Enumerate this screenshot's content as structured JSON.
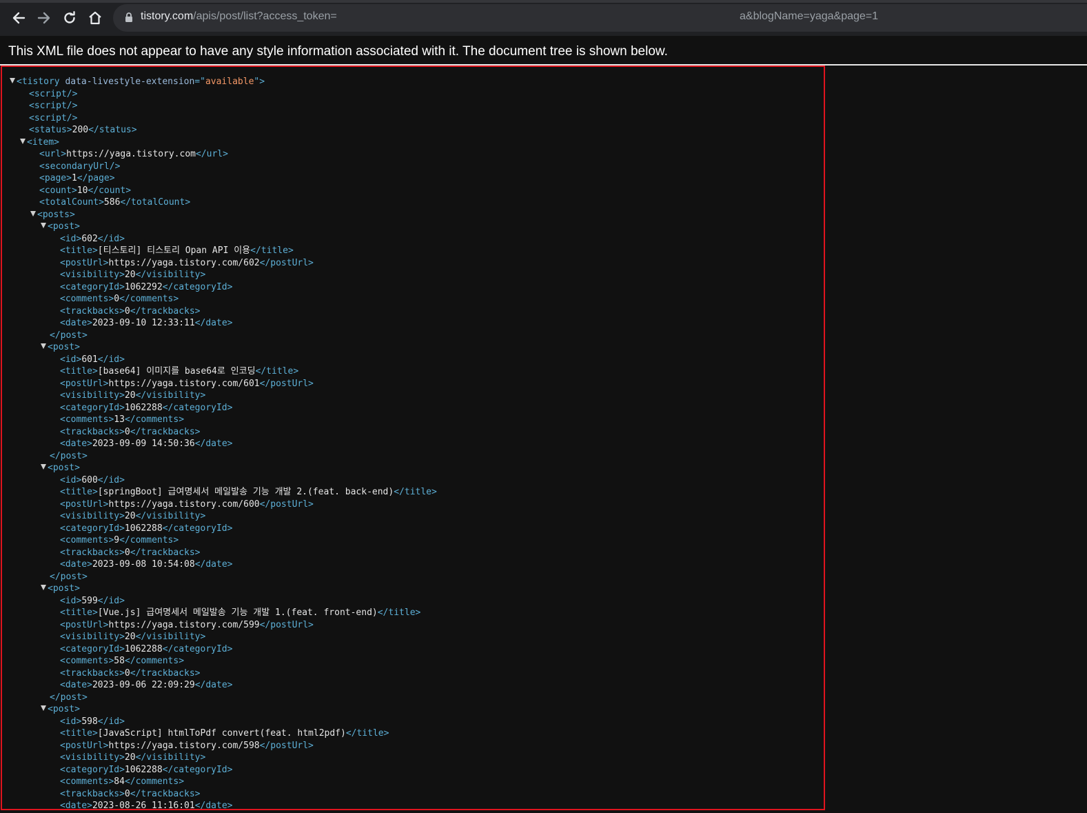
{
  "browser": {
    "url_host": "tistory.com",
    "url_path": "/apis/post/list?access_token=",
    "url_tail": "a&blogName=yaga&page=1"
  },
  "info_message": "This XML file does not appear to have any style information associated with it. The document tree is shown below.",
  "xml": {
    "root_attr_name": "data-livestyle-extension",
    "root_attr_value": "available",
    "status": "200",
    "url": "https://yaga.tistory.com",
    "page": "1",
    "count": "10",
    "totalCount": "586",
    "posts": [
      {
        "id": "602",
        "title": "[티스토리] 티스토리 Opan API 이용",
        "postUrl": "https://yaga.tistory.com/602",
        "visibility": "20",
        "categoryId": "1062292",
        "comments": "0",
        "trackbacks": "0",
        "date": "2023-09-10 12:33:11"
      },
      {
        "id": "601",
        "title": "[base64] 이미지를 base64로 인코딩",
        "postUrl": "https://yaga.tistory.com/601",
        "visibility": "20",
        "categoryId": "1062288",
        "comments": "13",
        "trackbacks": "0",
        "date": "2023-09-09 14:50:36"
      },
      {
        "id": "600",
        "title": "[springBoot] 급여명세서 메일발송 기능 개발 2.(feat. back-end)",
        "postUrl": "https://yaga.tistory.com/600",
        "visibility": "20",
        "categoryId": "1062288",
        "comments": "9",
        "trackbacks": "0",
        "date": "2023-09-08 10:54:08"
      },
      {
        "id": "599",
        "title": "[Vue.js] 급여명세서 메일발송 기능 개발 1.(feat. front-end)",
        "postUrl": "https://yaga.tistory.com/599",
        "visibility": "20",
        "categoryId": "1062288",
        "comments": "58",
        "trackbacks": "0",
        "date": "2023-09-06 22:09:29"
      },
      {
        "id": "598",
        "title": "[JavaScript] htmlToPdf convert(feat. html2pdf)",
        "postUrl": "https://yaga.tistory.com/598",
        "visibility": "20",
        "categoryId": "1062288",
        "comments": "84",
        "trackbacks": "0",
        "date": "2023-08-26 11:16:01"
      }
    ]
  }
}
